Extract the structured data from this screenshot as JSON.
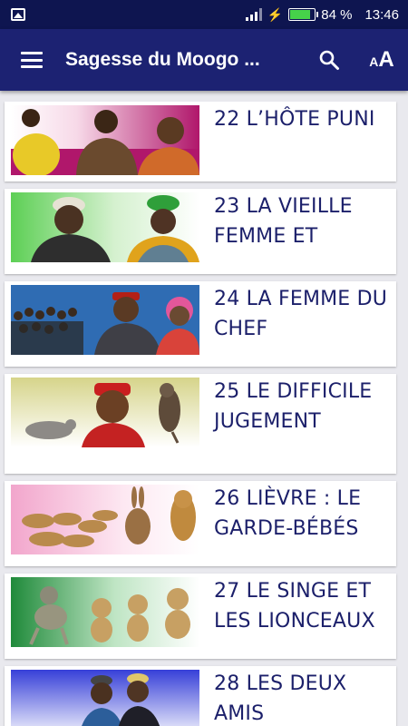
{
  "status_bar": {
    "battery_percent": "84 %",
    "time": "13:46",
    "battery_level": 0.84,
    "icons": [
      "gallery-icon",
      "signal-icon",
      "charging-icon",
      "battery-icon"
    ]
  },
  "app_bar": {
    "title": "Sagesse du Moogo ...",
    "menu_icon": "hamburger-menu-icon",
    "search_icon": "search-icon",
    "font_size_icon": "font-size-icon",
    "font_size_label_small": "A",
    "font_size_label_big": "A",
    "color": "#1c2272"
  },
  "colors": {
    "status_bar": "#0e1550",
    "title_text": "#1b1f6a",
    "background": "#e9e9ee",
    "card": "#ffffff"
  },
  "stories": [
    {
      "title": "22 L’HÔTE PUNI",
      "thumbnail": "pink gradient with three people"
    },
    {
      "title": "23 LA VIEILLE FEMME ET",
      "thumbnail": "green gradient with old man and woman"
    },
    {
      "title": "24 LA FEMME DU CHEF",
      "thumbnail": "blue background with crowd, man and woman"
    },
    {
      "title": "25 LE DIFFICILE JUGEMENT",
      "thumbnail": "olive gradient with dove, man and hawk"
    },
    {
      "title": "26 LIÈVRE : LE GARDE-BÉBÉS",
      "thumbnail": "pink gradient with lion cubs, hare and lioness"
    },
    {
      "title": "27 LE SINGE ET LES LIONCEAUX",
      "thumbnail": "green gradient with monkey and lion cubs"
    },
    {
      "title": "28 LES DEUX AMIS",
      "thumbnail": "blue gradient with two friends"
    }
  ]
}
